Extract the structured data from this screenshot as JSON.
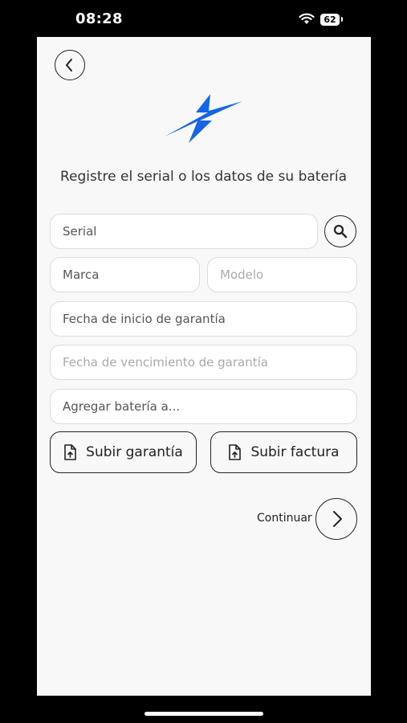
{
  "status_bar": {
    "time": "08:28",
    "battery": "62"
  },
  "header": {
    "back_icon": "chevron-left-icon",
    "logo_icon": "lightning-bolt-icon",
    "title": "Registre el serial o los datos de su batería"
  },
  "form": {
    "serial_placeholder": "Serial",
    "marca_placeholder": "Marca",
    "modelo_placeholder": "Modelo",
    "fecha_inicio_placeholder": "Fecha de inicio de garantía",
    "fecha_vencimiento_placeholder": "Fecha de vencimiento de garantía",
    "agregar_placeholder": "Agregar batería a..."
  },
  "actions": {
    "search_icon": "search-icon",
    "upload_warranty_label": "Subir garantía",
    "upload_invoice_label": "Subir factura",
    "continue_label": "Continuar"
  },
  "colors": {
    "accent": "#1565e6",
    "background": "#f8f8f8",
    "border": "#222222"
  }
}
